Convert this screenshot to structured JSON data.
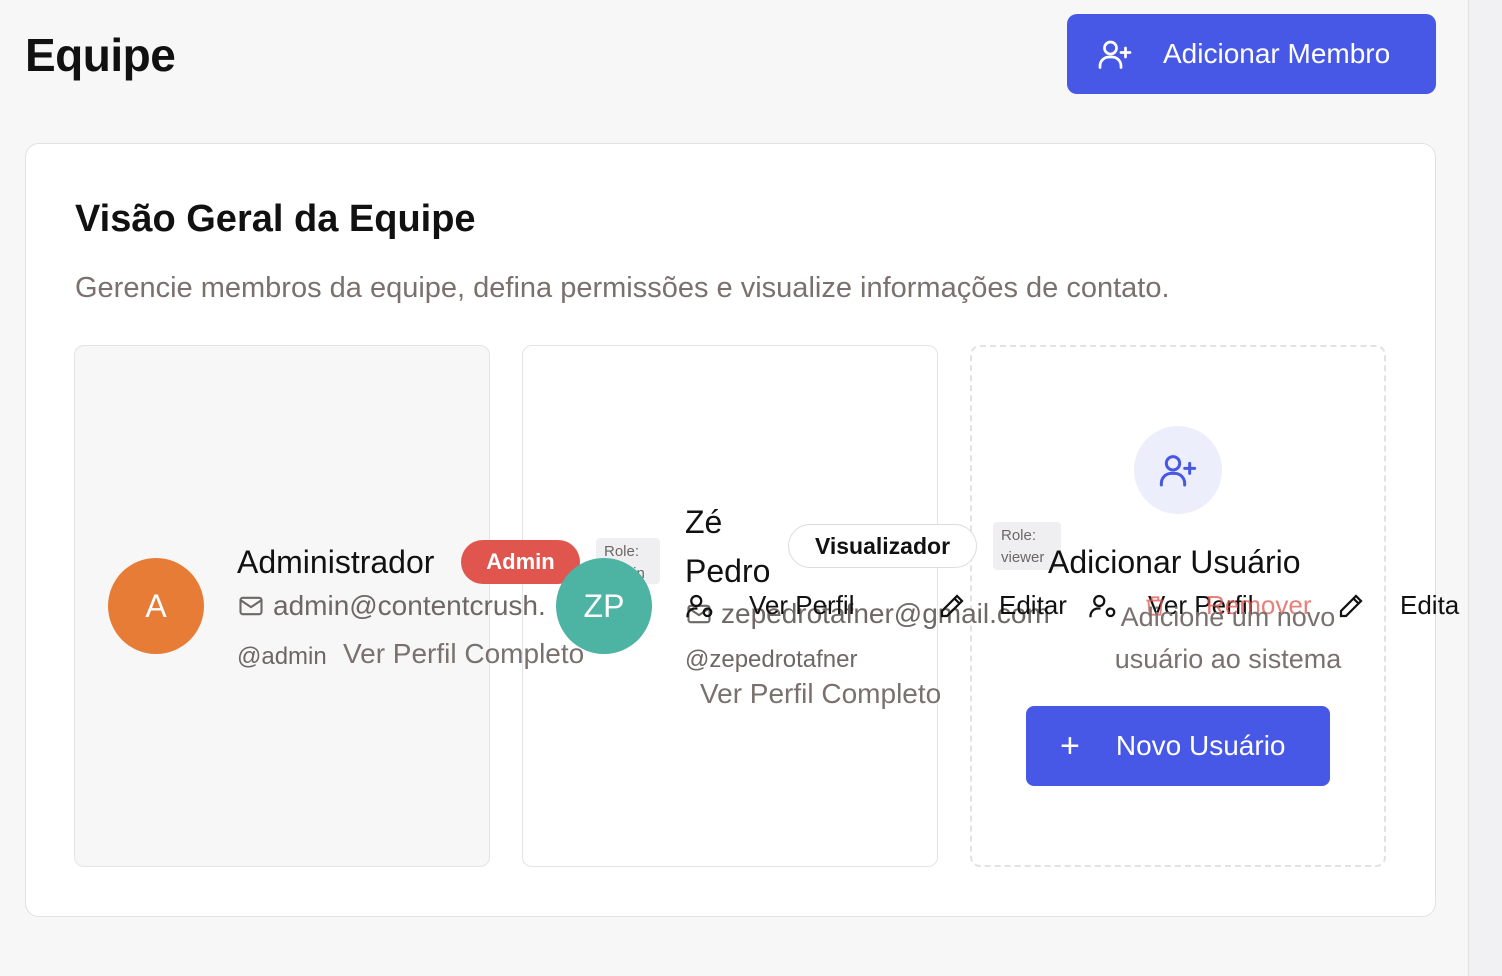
{
  "header": {
    "title": "Equipe",
    "add_member_label": "Adicionar Membro",
    "add_member_icon": "user-plus-icon"
  },
  "overview": {
    "title": "Visão Geral da Equipe",
    "description": "Gerencie membros da equipe, defina permissões e visualize informações de contato."
  },
  "members": [
    {
      "initials": "A",
      "name": "Administrador",
      "badge": "Admin",
      "role_chip": "Role:\nadmin",
      "email": "admin@contentcrush.",
      "username": "@admin",
      "profile_link": "Ver Perfil Completo",
      "avatar_color": "#e67c36"
    },
    {
      "initials": "ZP",
      "name_line1": "Zé",
      "name_line2": "Pedro",
      "badge": "Visualizador",
      "role_chip": "Role:\nviewer",
      "email": "zepedrotafner@gmail.com",
      "username": "@zepedrotafner",
      "profile_link": "Ver Perfil Completo",
      "avatar_color": "#4db3a2"
    }
  ],
  "actions": {
    "view_profile": "Ver Perfil",
    "edit": "Editar",
    "remove": "Remover",
    "edit_partial": "Edita"
  },
  "add_user_card": {
    "title": "Adicionar Usuário",
    "description": "Adicione um novo usuário ao sistema",
    "button_label": "Novo Usuário",
    "button_icon": "plus-icon"
  },
  "colors": {
    "primary": "#4758e6",
    "admin_badge": "#e0564f",
    "remove_text": "#e0564f"
  }
}
